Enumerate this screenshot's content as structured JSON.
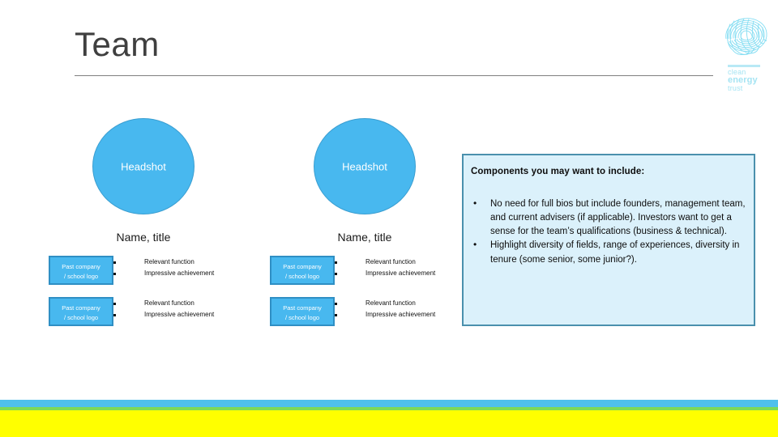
{
  "slide": {
    "title": "Team"
  },
  "logo": {
    "mark_name": "clean-energy-trust-swirl",
    "line1": "clean",
    "line2": "energy",
    "line3": "trust",
    "color": "#a5e4f3"
  },
  "people": [
    {
      "headshot_label": "Headshot",
      "name": "Name, title",
      "entries": [
        {
          "logo_line1": "Past company",
          "logo_line2": "/ school logo",
          "bullets": [
            "Relevant function",
            "Impressive achievement"
          ]
        },
        {
          "logo_line1": "Past company",
          "logo_line2": "/ school logo",
          "bullets": [
            "Relevant function",
            "Impressive achievement"
          ]
        }
      ]
    },
    {
      "headshot_label": "Headshot",
      "name": "Name, title",
      "entries": [
        {
          "logo_line1": "Past company",
          "logo_line2": "/ school logo",
          "bullets": [
            "Relevant function",
            "Impressive achievement"
          ]
        },
        {
          "logo_line1": "Past company",
          "logo_line2": "/ school logo",
          "bullets": [
            "Relevant function",
            "Impressive achievement"
          ]
        }
      ]
    }
  ],
  "callout": {
    "heading": "Components you may want to include:",
    "bullets": [
      "No need for full bios but include founders, management team, and current advisers (if applicable). Investors want to get a sense for the team’s qualifications (business & technical).",
      "Highlight diversity of fields, range of experiences, diversity in tenure (some senior, some junior?)."
    ],
    "background": "#dbf1fb",
    "border": "#4a90ad"
  },
  "footer_bars": {
    "blue": "#4fc0ec",
    "green": "#7ed957",
    "yellow": "#ffff00"
  },
  "theme": {
    "headshot_fill": "#48b8ef",
    "headshot_border": "#3a9ed1",
    "entry_logo_fill": "#48b8ef",
    "entry_logo_border": "#2f8fc4",
    "title_color": "#3f3f3f",
    "rule_color": "#808080"
  }
}
